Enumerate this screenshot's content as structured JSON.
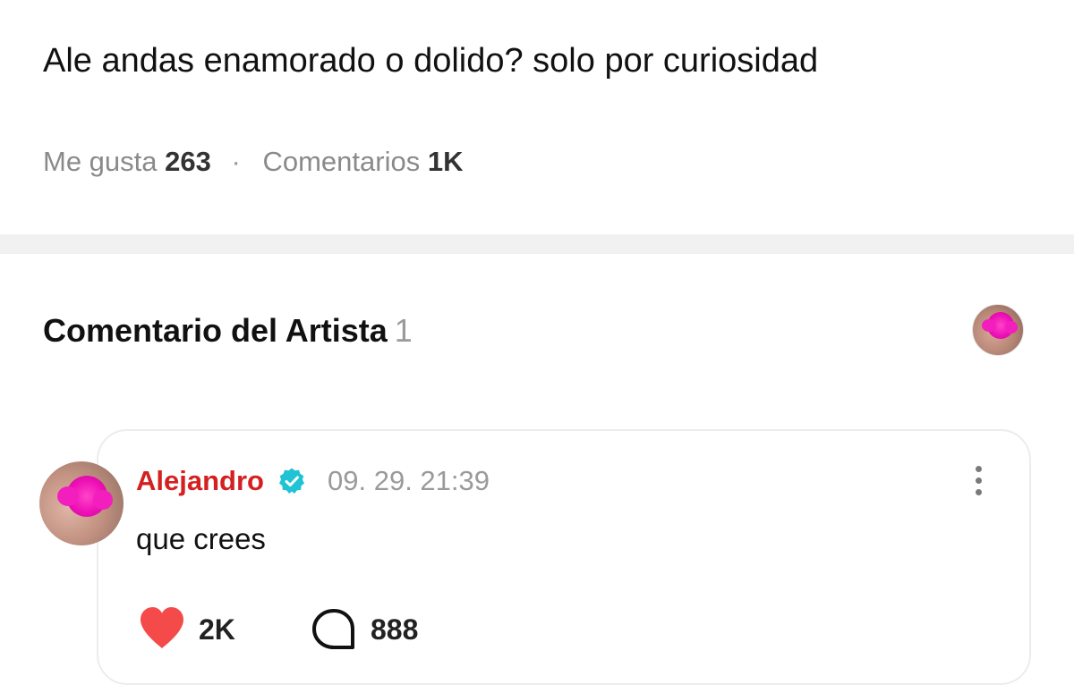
{
  "post": {
    "text": "Ale andas enamorado o dolido? solo por curiosidad",
    "likes_label": "Me gusta",
    "likes_count": "263",
    "separator": "·",
    "comments_label": "Comentarios",
    "comments_count": "1K"
  },
  "artist_section": {
    "title": "Comentario del Artista",
    "count": "1",
    "avatar_icon": "profile-avatar-pink-flower"
  },
  "comment": {
    "author": "Alejandro",
    "verified_icon": "verified-badge-icon",
    "timestamp": "09. 29. 21:39",
    "text": "que crees",
    "likes": "2K",
    "replies": "888",
    "like_icon": "heart-icon",
    "reply_icon": "speech-bubble-icon",
    "menu_icon": "more-vertical-icon"
  },
  "colors": {
    "author": "#d42020",
    "heart": "#f44a4a",
    "verified": "#1fc3d4",
    "muted": "#9a9a9a",
    "divider": "#f1f1f1"
  }
}
